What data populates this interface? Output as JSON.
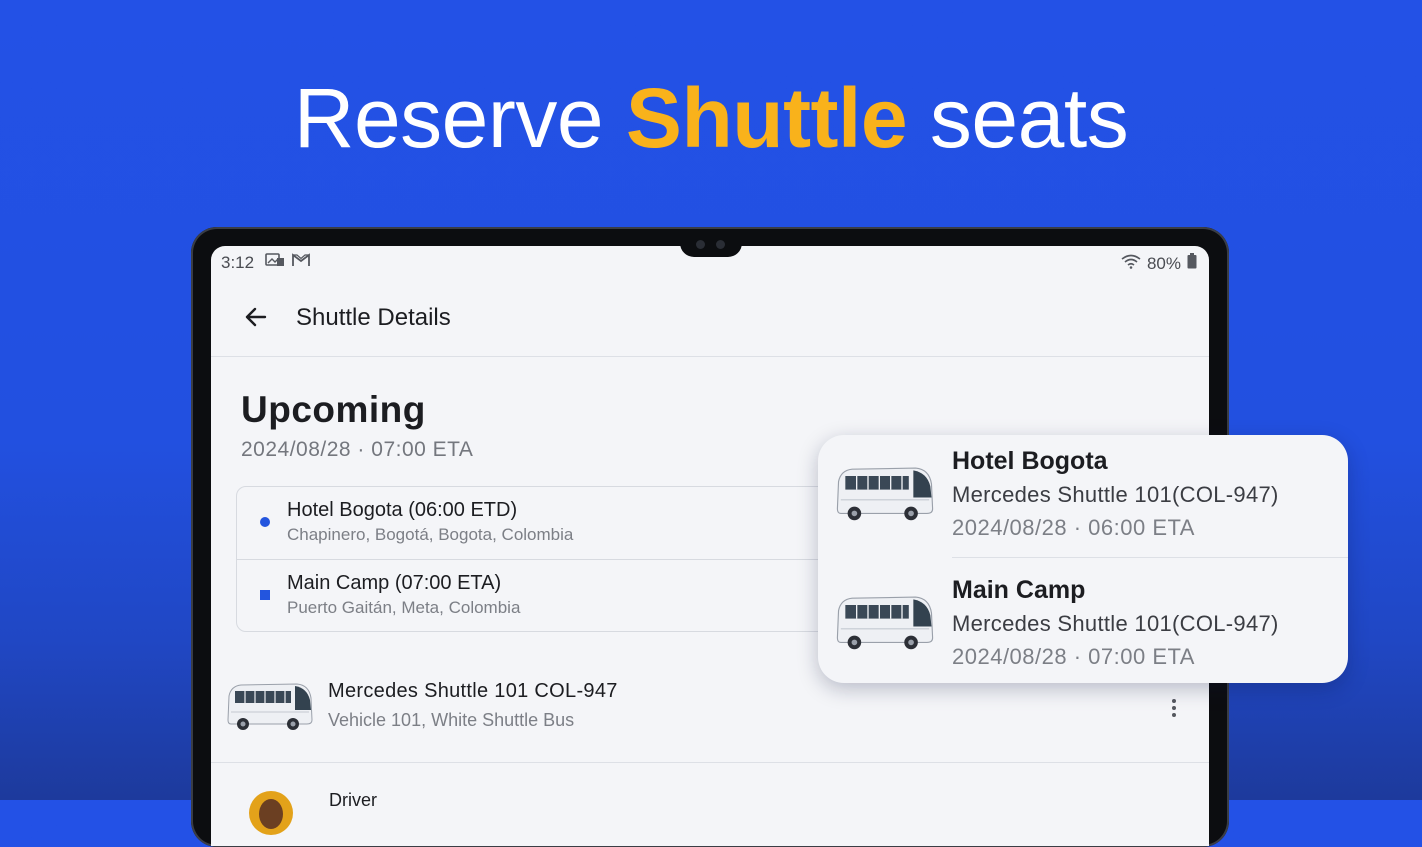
{
  "headline": {
    "before": "Reserve ",
    "highlight": "Shuttle",
    "after": " seats",
    "highlight_color": "#f9b21b"
  },
  "status_bar": {
    "time": "3:12",
    "battery": "80%",
    "icons": [
      "image-notification-icon",
      "gmail-icon",
      "wifi-icon",
      "battery-icon"
    ]
  },
  "app_bar": {
    "title": "Shuttle Details"
  },
  "trip": {
    "status": "Upcoming",
    "date": "2024/08/28 · 07:00 ETA",
    "stops": [
      {
        "name": "Hotel Bogota (06:00 ETD)",
        "address": "Chapinero, Bogotá, Bogota, Colombia"
      },
      {
        "name": "Main Camp (07:00 ETA)",
        "address": "Puerto Gaitán, Meta, Colombia"
      }
    ]
  },
  "vehicle": {
    "name": "Mercedes Shuttle 101 COL-947",
    "description": "Vehicle 101, White Shuttle Bus"
  },
  "driver": {
    "label": "Driver"
  },
  "floating_card": {
    "items": [
      {
        "title": "Hotel Bogota",
        "vehicle": "Mercedes Shuttle 101(COL-947)",
        "date": "2024/08/28 · 06:00 ETA"
      },
      {
        "title": "Main Camp",
        "vehicle": "Mercedes Shuttle 101(COL-947)",
        "date": "2024/08/28 · 07:00 ETA"
      }
    ]
  },
  "colors": {
    "background": "#2351e6",
    "accent": "#2355de"
  }
}
